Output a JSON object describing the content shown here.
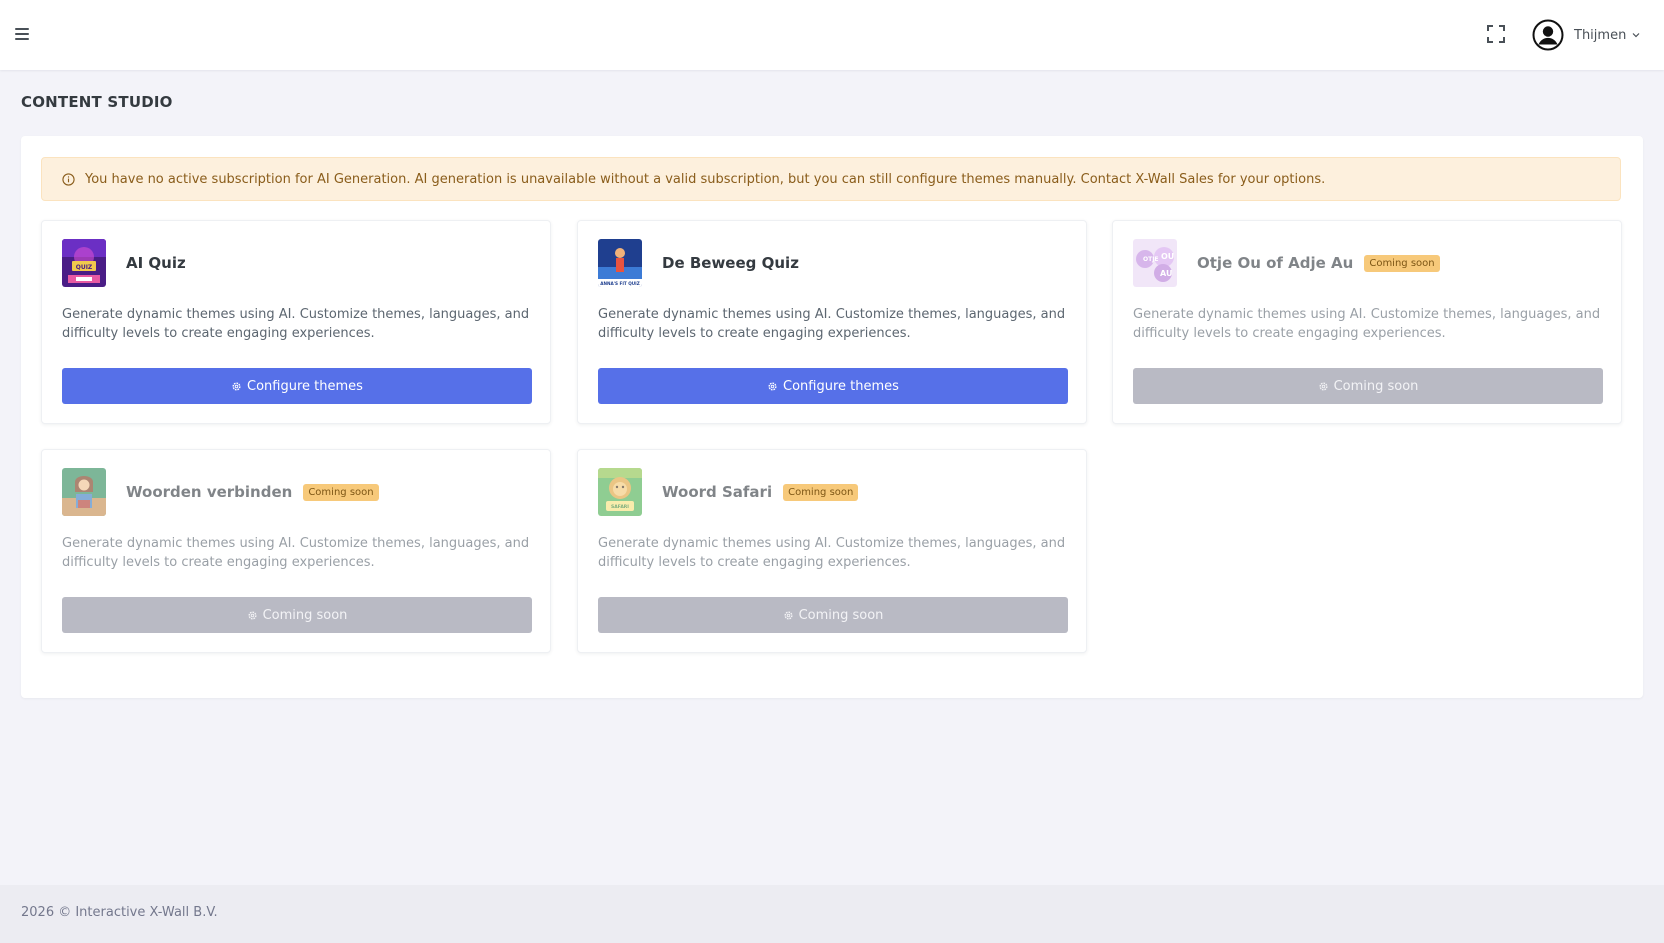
{
  "header": {
    "menu_icon": "hamburger-icon",
    "fullscreen_icon": "fullscreen-icon",
    "user": {
      "name": "Thijmen",
      "avatar_icon": "user-circle-icon"
    }
  },
  "page": {
    "title": "CONTENT STUDIO"
  },
  "alert": {
    "icon": "info-circle-icon",
    "text": "You have no active subscription for AI Generation. AI generation is unavailable without a valid subscription, but you can still configure themes manually. Contact X-Wall Sales for your options."
  },
  "apps": [
    {
      "title": "AI Quiz",
      "badge": "",
      "description": "Generate dynamic themes using AI. Customize themes, languages, and difficulty levels to create engaging experiences.",
      "button": "Configure themes",
      "enabled": true
    },
    {
      "title": "De Beweeg Quiz",
      "badge": "",
      "description": "Generate dynamic themes using AI. Customize themes, languages, and difficulty levels to create engaging experiences.",
      "button": "Configure themes",
      "enabled": true
    },
    {
      "title": "Otje Ou of Adje Au",
      "badge": "Coming soon",
      "description": "Generate dynamic themes using AI. Customize themes, languages, and difficulty levels to create engaging experiences.",
      "button": "Coming soon",
      "enabled": false
    },
    {
      "title": "Woorden verbinden",
      "badge": "Coming soon",
      "description": "Generate dynamic themes using AI. Customize themes, languages, and difficulty levels to create engaging experiences.",
      "button": "Coming soon",
      "enabled": false
    },
    {
      "title": "Woord Safari",
      "badge": "Coming soon",
      "description": "Generate dynamic themes using AI. Customize themes, languages, and difficulty levels to create engaging experiences.",
      "button": "Coming soon",
      "enabled": false
    }
  ],
  "colors": {
    "primary_button": "#5670e8",
    "disabled_button": "#b9bac4",
    "badge": "#f7c97a",
    "alert_bg": "#fdf0dd"
  },
  "footer": {
    "text": "2026 © Interactive X-Wall B.V."
  }
}
